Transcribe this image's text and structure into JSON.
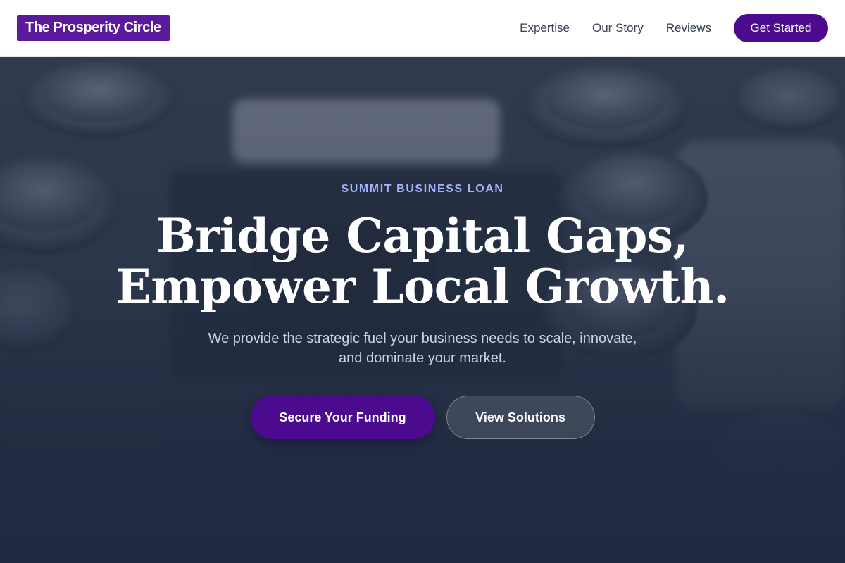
{
  "header": {
    "brand": "The Prosperity Circle",
    "nav": [
      {
        "label": "Expertise"
      },
      {
        "label": "Our Story"
      },
      {
        "label": "Reviews"
      }
    ],
    "cta_label": "Get Started"
  },
  "hero": {
    "eyebrow": "SUMMIT BUSINESS LOAN",
    "headline_line1": "Bridge Capital Gaps,",
    "headline_line2": "Empower Local Growth.",
    "subtext_line1": "We provide the strategic fuel your business needs to scale, innovate,",
    "subtext_line2": "and dominate your market.",
    "primary_button": "Secure Your Funding",
    "secondary_button": "View Solutions",
    "background_image": "cash-register-keys-photo"
  },
  "colors": {
    "brand": "#5b1a9c",
    "primary": "#4c0a8f",
    "eyebrow": "#a5b4fc",
    "hero_bg": "#1f2a40"
  }
}
